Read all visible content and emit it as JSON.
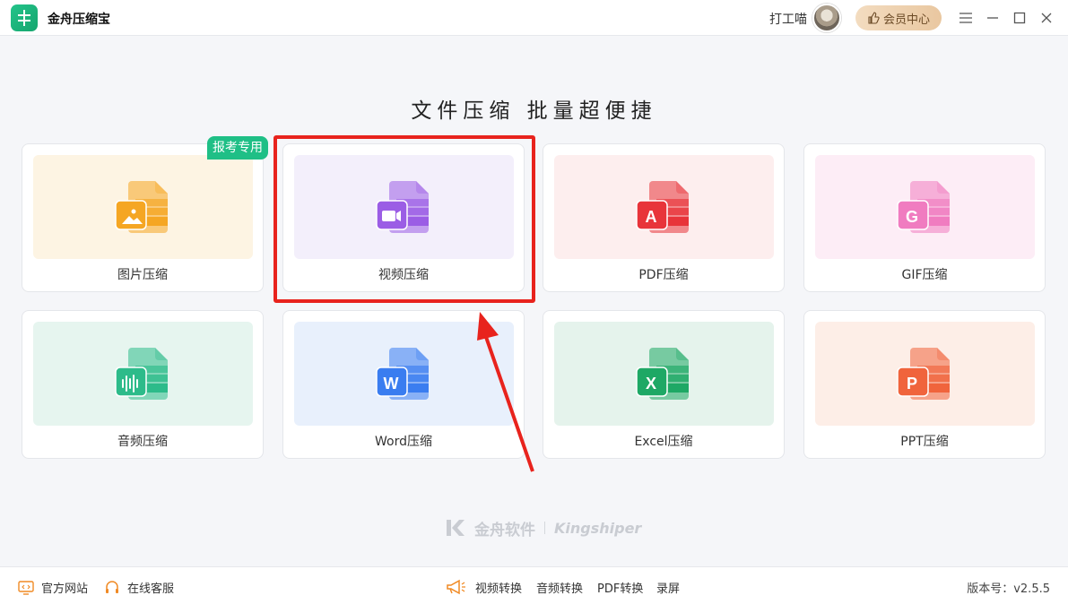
{
  "app": {
    "name": "金舟压缩宝"
  },
  "user": {
    "name": "打工喵"
  },
  "header": {
    "vip_label": "会员中心"
  },
  "headline": "文件压缩  批量超便捷",
  "badge": "报考专用",
  "cards": [
    {
      "label": "图片压缩",
      "icon": "image-file-icon",
      "bg": "#fdf4e3",
      "color": "#f5a623"
    },
    {
      "label": "视频压缩",
      "icon": "video-file-icon",
      "bg": "#f3effb",
      "color": "#9b5de5"
    },
    {
      "label": "PDF压缩",
      "icon": "pdf-file-icon",
      "bg": "#fdeeee",
      "color": "#e8343a",
      "glyph": "A"
    },
    {
      "label": "GIF压缩",
      "icon": "gif-file-icon",
      "bg": "#fdedf6",
      "color": "#f07cc0",
      "glyph": "G"
    },
    {
      "label": "音频压缩",
      "icon": "audio-file-icon",
      "bg": "#e6f5ef",
      "color": "#2dbb8a"
    },
    {
      "label": "Word压缩",
      "icon": "word-file-icon",
      "bg": "#e8f0fc",
      "color": "#3a7df0",
      "glyph": "W"
    },
    {
      "label": "Excel压缩",
      "icon": "excel-file-icon",
      "bg": "#e5f3ec",
      "color": "#1ea865",
      "glyph": "X"
    },
    {
      "label": "PPT压缩",
      "icon": "ppt-file-icon",
      "bg": "#fdeee7",
      "color": "#f0643c",
      "glyph": "P"
    }
  ],
  "brand": {
    "cn": "金舟软件",
    "en": "Kingshiper"
  },
  "footer": {
    "official_site": "官方网站",
    "online_service": "在线客服",
    "links": [
      "视频转换",
      "音频转换",
      "PDF转换",
      "录屏"
    ],
    "version": "版本号：v2.5.5"
  }
}
